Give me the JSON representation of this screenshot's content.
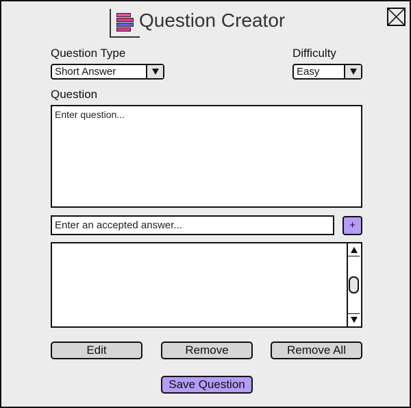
{
  "header": {
    "title": "Question Creator",
    "logo_icon": "stacked-bars-icon",
    "logo_colors": [
      "#ec4fa6",
      "#e0388a",
      "#6b5bd6",
      "#e0388a"
    ],
    "close_icon": "close-x-icon"
  },
  "form": {
    "question_type": {
      "label": "Question Type",
      "value": "Short Answer",
      "icon": "chevron-down-icon"
    },
    "difficulty": {
      "label": "Difficulty",
      "value": "Easy",
      "icon": "chevron-down-icon"
    },
    "question": {
      "label": "Question",
      "placeholder": "Enter question..."
    },
    "answer": {
      "placeholder": "Enter an accepted answer...",
      "add_label": "+"
    },
    "answers_list": {
      "items": [],
      "scroll_up_icon": "arrow-up-icon",
      "scroll_down_icon": "arrow-down-icon"
    }
  },
  "actions": {
    "edit_label": "Edit",
    "remove_label": "Remove",
    "remove_all_label": "Remove All",
    "save_label": "Save Question"
  },
  "colors": {
    "accent": "#b59cf7",
    "button_gray": "#d6d6d6",
    "window_bg": "#ececec"
  }
}
